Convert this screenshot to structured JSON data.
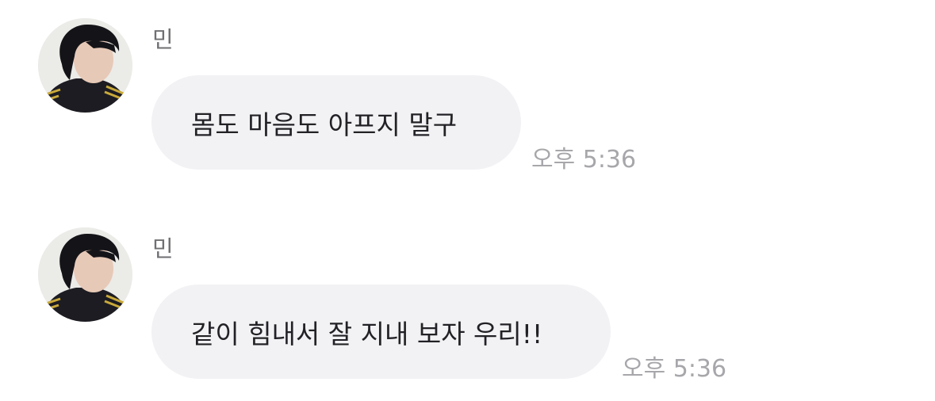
{
  "messages": [
    {
      "sender": "민",
      "text": "몸도 마음도 아프지 말구",
      "time": "오후 5:36",
      "avatar_icon": "profile-photo"
    },
    {
      "sender": "민",
      "text": "같이 힘내서 잘 지내 보자 우리!!",
      "time": "오후 5:36",
      "avatar_icon": "profile-photo"
    }
  ],
  "colors": {
    "bubble_background": "#f2f2f5",
    "message_text": "#222226",
    "sender_name": "#6f6f73",
    "timestamp": "#a7a7ab"
  }
}
